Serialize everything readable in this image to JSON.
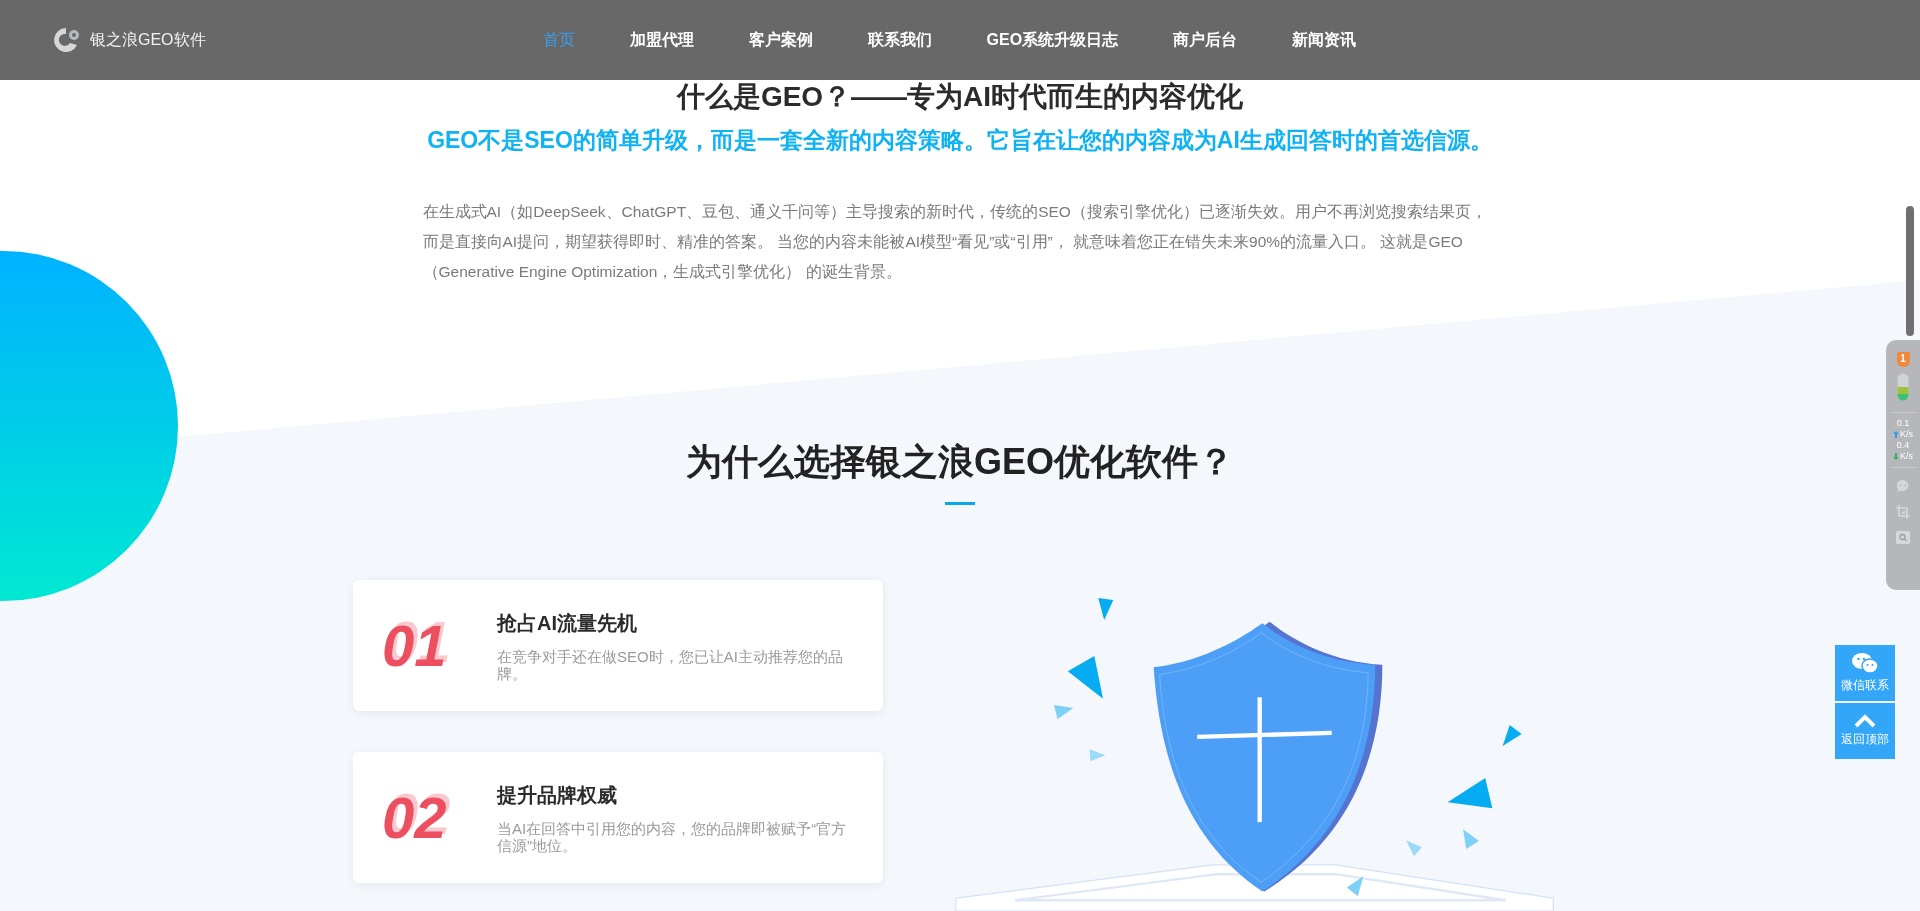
{
  "nav": {
    "logo_text": "银之浪GEO软件",
    "items": [
      {
        "label": "首页",
        "selected": true
      },
      {
        "label": "加盟代理",
        "selected": false
      },
      {
        "label": "客户案例",
        "selected": false
      },
      {
        "label": "联系我们",
        "selected": false
      },
      {
        "label": "GEO系统升级日志",
        "selected": false
      },
      {
        "label": "商户后台",
        "selected": false
      },
      {
        "label": "新闻资讯",
        "selected": false
      }
    ]
  },
  "intro": {
    "title": "什么是GEO？——专为AI时代而生的内容优化",
    "subtitle": "GEO不是SEO的简单升级，而是一套全新的内容策略。它旨在让您的内容成为AI生成回答时的首选信源。",
    "paragraph": "在生成式AI（如DeepSeek、ChatGPT、豆包、通义千问等）主导搜索的新时代，传统的SEO（搜索引擎优化）已逐渐失效。用户不再浏览搜索结果页，而是直接向AI提问，期望获得即时、精准的答案。 当您的内容未能被AI模型“看见”或“引用”， 就意味着您正在错失未来90%的流量入口。 这就是GEO（Generative Engine Optimization，生成式引擎优化） 的诞生背景。"
  },
  "features": {
    "title": "为什么选择银之浪GEO优化软件？",
    "cards": [
      {
        "number": "01",
        "title": "抢占AI流量先机",
        "description": "在竞争对手还在做SEO时，您已让AI主动推荐您的品牌。"
      },
      {
        "number": "02",
        "title": "提升品牌权威",
        "description": "当AI在回答中引用您的内容，您的品牌即被赋予“官方信源”地位。"
      }
    ]
  },
  "monitor": {
    "badge": "1",
    "upload_rate": "0.1",
    "upload_unit": "K/s",
    "download_rate": "0.4",
    "download_unit": "K/s"
  },
  "side_buttons": [
    {
      "kind": "wechat",
      "label": "微信联系"
    },
    {
      "kind": "top",
      "label": "返回顶部"
    }
  ]
}
